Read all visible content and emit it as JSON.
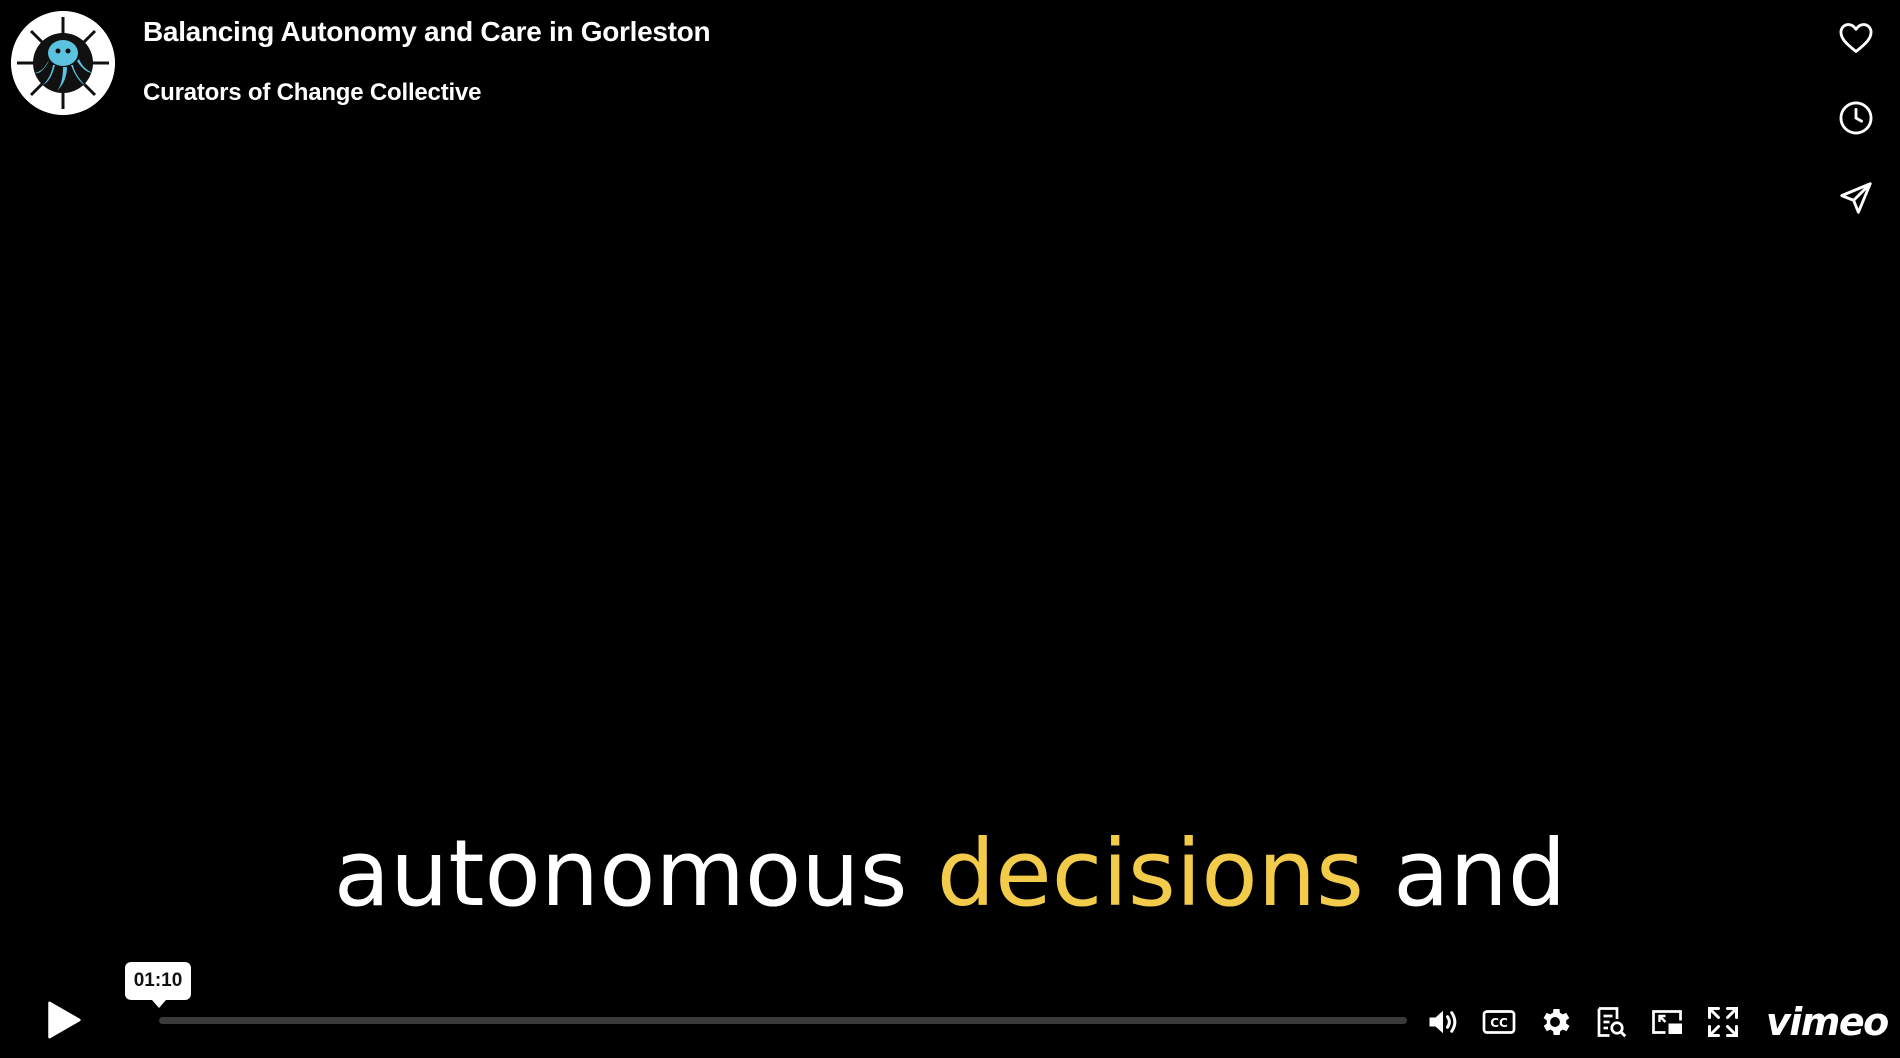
{
  "video": {
    "title": "Balancing Autonomy and Care in Gorleston",
    "byline": "Curators of Change Collective"
  },
  "caption": {
    "before": "autonomous ",
    "highlight": "decisions",
    "after": " and",
    "highlight_color": "#f2cb4b"
  },
  "controls": {
    "hover_time": "01:10",
    "brand": "vimeo"
  },
  "icons": {
    "like": "heart-icon",
    "watch_later": "clock-icon",
    "share": "paper-plane-icon",
    "play": "play-icon",
    "volume": "volume-icon",
    "captions": "cc-icon",
    "settings": "gear-icon",
    "transcript": "transcript-icon",
    "pip": "picture-in-picture-icon",
    "fullscreen": "fullscreen-icon"
  }
}
